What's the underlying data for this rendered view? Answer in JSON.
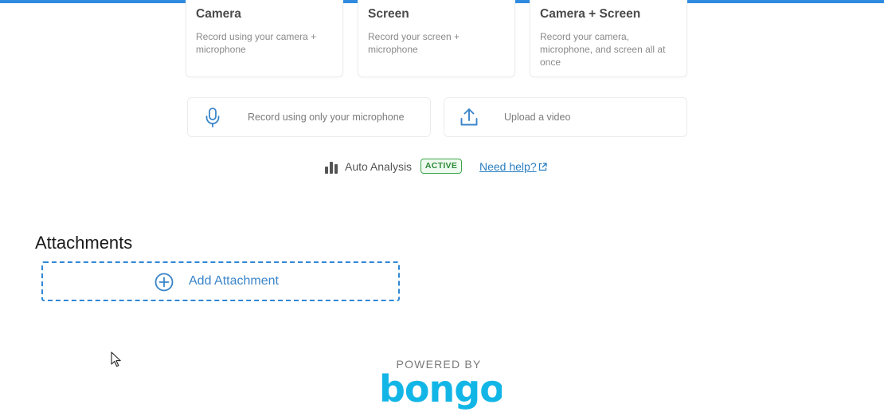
{
  "cards": [
    {
      "title": "Camera",
      "description": "Record using your camera + microphone"
    },
    {
      "title": "Screen",
      "description": "Record your screen + microphone"
    },
    {
      "title": "Camera + Screen",
      "description": "Record your camera, microphone, and screen all at once"
    }
  ],
  "options": [
    {
      "icon": "microphone-icon",
      "label": "Record using only your microphone"
    },
    {
      "icon": "upload-icon",
      "label": "Upload a video"
    }
  ],
  "analysis": {
    "icon": "bar-chart-icon",
    "label": "Auto Analysis",
    "badge": "ACTIVE",
    "help_link": "Need help?",
    "help_icon": "external-link-icon"
  },
  "attachments": {
    "heading": "Attachments",
    "add_label": "Add Attachment",
    "add_icon": "plus-circle-icon"
  },
  "footer": {
    "powered_by": "POWERED BY",
    "logo_text": "bongo"
  },
  "colors": {
    "accent": "#2e8be0",
    "link": "#2b7fc1",
    "badge_green": "#3aa54a",
    "logo_cyan": "#12b6e6"
  }
}
